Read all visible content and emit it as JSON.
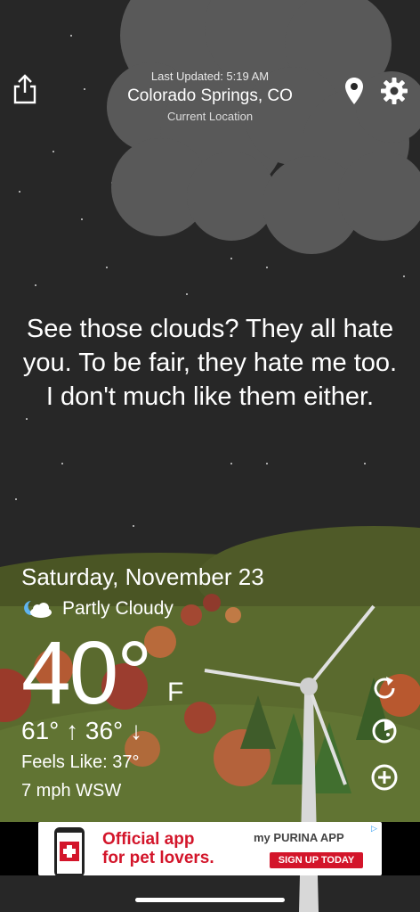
{
  "header": {
    "last_updated": "Last Updated: 5:19 AM",
    "location": "Colorado Springs, CO",
    "location_type": "Current Location"
  },
  "toolbar": {
    "share_icon": "share-icon",
    "location_pin_icon": "location-pin-icon",
    "settings_icon": "gear-icon"
  },
  "quote": "See those clouds? They all hate you. To be fair, they hate me too. I don't much like them either.",
  "weather": {
    "date": "Saturday, November 23",
    "condition": "Partly Cloudy",
    "condition_icon": "partly-cloudy-night-icon",
    "temperature": "40°",
    "unit": "F",
    "hi_lo": "61° ↑  36° ↓",
    "feels_like": "Feels Like: 37°",
    "wind": "7 mph WSW"
  },
  "side_actions": {
    "refresh_icon": "refresh-icon",
    "radar_icon": "radar-icon",
    "add_icon": "plus-circle-icon"
  },
  "ad": {
    "text_line1": "Official app",
    "text_line2": "for pet lovers.",
    "brand": "my PURINA APP",
    "cta": "SIGN UP TODAY",
    "badge": "▷"
  },
  "colors": {
    "sky": "#262626",
    "cloud": "#5a5a5a",
    "hill": "#5d6b2f",
    "ad_red": "#d3152a"
  }
}
